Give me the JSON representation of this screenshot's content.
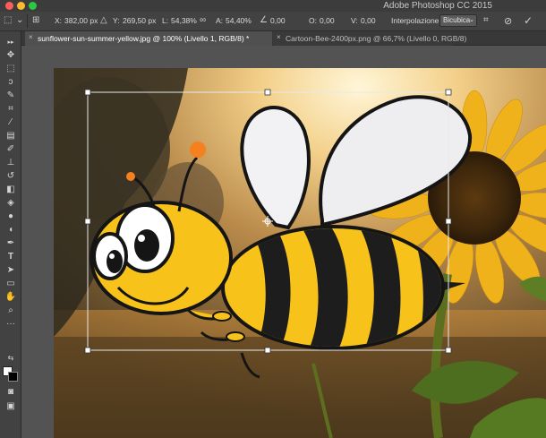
{
  "window": {
    "app_title": "Adobe Photoshop CC 2015"
  },
  "options_bar": {
    "x_label": "X:",
    "x_value": "382,00 px",
    "y_label": "Y:",
    "y_value": "269,50 px",
    "l_label": "L:",
    "l_value": "54,38%",
    "a_label": "A:",
    "a_value": "54,40%",
    "angle_value": "0,00",
    "o_label": "O:",
    "o_value": "0,00",
    "v_label": "V:",
    "v_value": "0,00",
    "interp_label": "Interpolazione:",
    "interp_value": "Bicubica"
  },
  "tabs": [
    {
      "label": "sunflower-sun-summer-yellow.jpg @ 100% (Livello 1, RGB/8) *",
      "active": true
    },
    {
      "label": "Cartoon-Bee-2400px.png @ 66,7% (Livello 0, RGB/8)",
      "active": false
    }
  ],
  "colors": {
    "foreground": "#ffffff",
    "background": "#000000",
    "bee_yellow": "#f7c21a",
    "bee_black": "#1d1d1d"
  },
  "icons": {
    "close_icon": "×",
    "reference_point_icon": "⊞",
    "delta_icon": "△",
    "link_icon": "∞",
    "angle_icon": "∠",
    "warp_icon": "⌗",
    "cancel_icon": "⊘",
    "commit_icon": "✓",
    "chevron": "⌄"
  }
}
